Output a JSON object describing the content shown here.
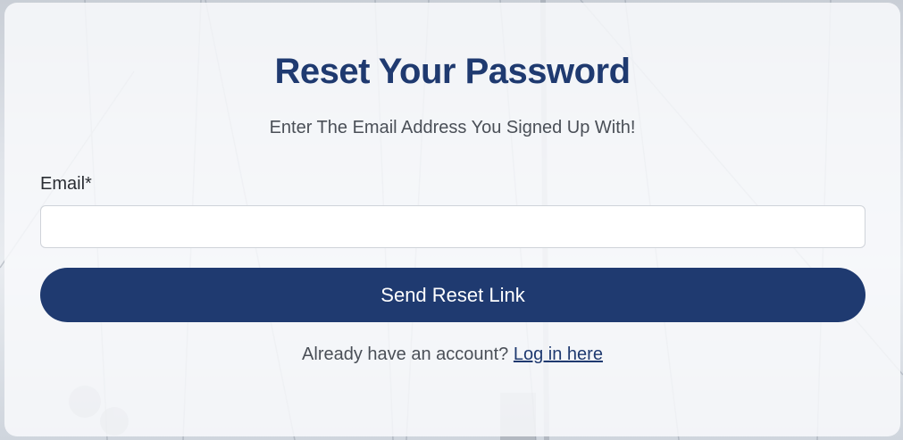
{
  "page": {
    "title": "Reset Your Password",
    "subtitle": "Enter The Email Address You Signed Up With!"
  },
  "form": {
    "email_label": "Email*",
    "email_value": "",
    "email_placeholder": "",
    "submit_label": "Send Reset Link"
  },
  "footer": {
    "prompt": "Already have an account?",
    "link_label": "Log in here"
  },
  "colors": {
    "brand_navy": "#1f3a70",
    "card_background": "#f8f9fb",
    "button_text": "#ffffff"
  }
}
